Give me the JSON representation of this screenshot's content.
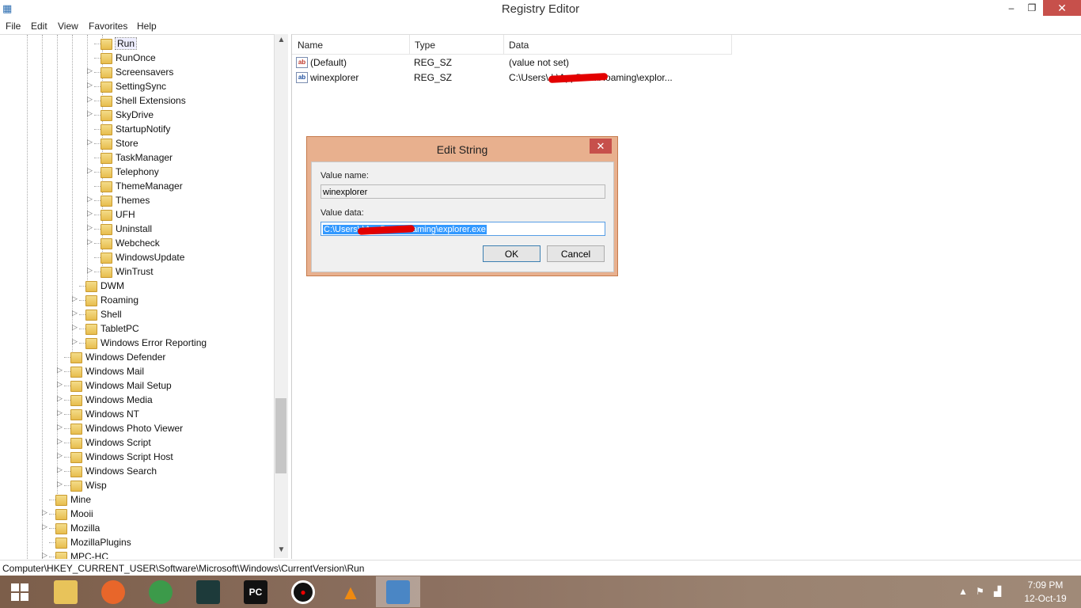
{
  "window": {
    "title": "Registry Editor",
    "minimize": "–",
    "maximize": "❐",
    "close": "✕"
  },
  "menu": [
    "File",
    "Edit",
    "View",
    "Favorites",
    "Help"
  ],
  "tree": {
    "selected": "Run",
    "items": [
      {
        "label": "Run",
        "level": 3,
        "expand": ""
      },
      {
        "label": "RunOnce",
        "level": 3,
        "expand": ""
      },
      {
        "label": "Screensavers",
        "level": 3,
        "expand": "▷"
      },
      {
        "label": "SettingSync",
        "level": 3,
        "expand": "▷"
      },
      {
        "label": "Shell Extensions",
        "level": 3,
        "expand": "▷"
      },
      {
        "label": "SkyDrive",
        "level": 3,
        "expand": "▷"
      },
      {
        "label": "StartupNotify",
        "level": 3,
        "expand": ""
      },
      {
        "label": "Store",
        "level": 3,
        "expand": "▷"
      },
      {
        "label": "TaskManager",
        "level": 3,
        "expand": ""
      },
      {
        "label": "Telephony",
        "level": 3,
        "expand": "▷"
      },
      {
        "label": "ThemeManager",
        "level": 3,
        "expand": ""
      },
      {
        "label": "Themes",
        "level": 3,
        "expand": "▷"
      },
      {
        "label": "UFH",
        "level": 3,
        "expand": "▷"
      },
      {
        "label": "Uninstall",
        "level": 3,
        "expand": "▷"
      },
      {
        "label": "Webcheck",
        "level": 3,
        "expand": "▷"
      },
      {
        "label": "WindowsUpdate",
        "level": 3,
        "expand": ""
      },
      {
        "label": "WinTrust",
        "level": 3,
        "expand": "▷"
      },
      {
        "label": "DWM",
        "level": 2,
        "expand": ""
      },
      {
        "label": "Roaming",
        "level": 2,
        "expand": "▷"
      },
      {
        "label": "Shell",
        "level": 2,
        "expand": "▷"
      },
      {
        "label": "TabletPC",
        "level": 2,
        "expand": "▷"
      },
      {
        "label": "Windows Error Reporting",
        "level": 2,
        "expand": "▷"
      },
      {
        "label": "Windows Defender",
        "level": 1,
        "expand": ""
      },
      {
        "label": "Windows Mail",
        "level": 1,
        "expand": "▷"
      },
      {
        "label": "Windows Mail Setup",
        "level": 1,
        "expand": "▷"
      },
      {
        "label": "Windows Media",
        "level": 1,
        "expand": "▷"
      },
      {
        "label": "Windows NT",
        "level": 1,
        "expand": "▷"
      },
      {
        "label": "Windows Photo Viewer",
        "level": 1,
        "expand": "▷"
      },
      {
        "label": "Windows Script",
        "level": 1,
        "expand": "▷"
      },
      {
        "label": "Windows Script Host",
        "level": 1,
        "expand": "▷"
      },
      {
        "label": "Windows Search",
        "level": 1,
        "expand": "▷"
      },
      {
        "label": "Wisp",
        "level": 1,
        "expand": "▷"
      },
      {
        "label": "Mine",
        "level": 0,
        "expand": ""
      },
      {
        "label": "Mooii",
        "level": 0,
        "expand": "▷"
      },
      {
        "label": "Mozilla",
        "level": 0,
        "expand": "▷"
      },
      {
        "label": "MozillaPlugins",
        "level": 0,
        "expand": ""
      },
      {
        "label": "MPC-HC",
        "level": 0,
        "expand": "▷"
      }
    ]
  },
  "list": {
    "columns": [
      "Name",
      "Type",
      "Data"
    ],
    "rows": [
      {
        "name": "(Default)",
        "type": "REG_SZ",
        "data": "(value not set)",
        "icon": "ab"
      },
      {
        "name": "winexplorer",
        "type": "REG_SZ",
        "data": "C:\\Users\\             h\\AppData\\Roaming\\explor...",
        "icon": "ab"
      }
    ]
  },
  "dialog": {
    "title": "Edit String",
    "close": "✕",
    "value_name_label": "Value name:",
    "value_name": "winexplorer",
    "value_data_label": "Value data:",
    "value_data": "C:\\Users\\            \\AppData\\Roaming\\explorer.exe",
    "ok": "OK",
    "cancel": "Cancel"
  },
  "status": "Computer\\HKEY_CURRENT_USER\\Software\\Microsoft\\Windows\\CurrentVersion\\Run",
  "taskbar": {
    "apps": [
      {
        "name": "file-explorer",
        "glyph": "",
        "color": "#e8c35a"
      },
      {
        "name": "firefox",
        "glyph": "",
        "color": "#e8662a"
      },
      {
        "name": "chrome",
        "glyph": "",
        "color": "#3c9a4a"
      },
      {
        "name": "filmora",
        "glyph": "",
        "color": "#1d3a3a"
      },
      {
        "name": "pycharm",
        "glyph": "PC",
        "color": "#111111"
      },
      {
        "name": "recorder",
        "glyph": "●",
        "color": "#111111"
      },
      {
        "name": "vlc",
        "glyph": "▲",
        "color": "#e98a16"
      },
      {
        "name": "regedit",
        "glyph": "",
        "color": "#4a86c5"
      }
    ],
    "time": "7:09 PM",
    "date": "12-Oct-19"
  },
  "colors": {
    "dialog_frame": "#e8b08e",
    "close_red": "#c7504b",
    "selection": "#3399ff"
  }
}
